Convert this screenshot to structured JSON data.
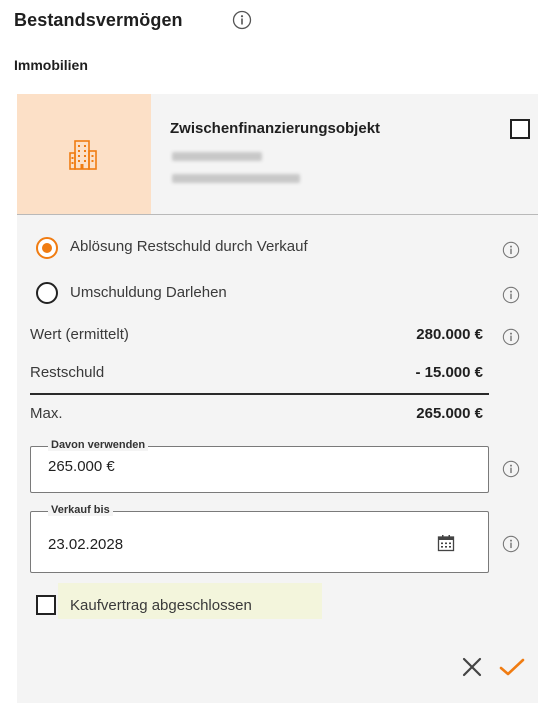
{
  "section": {
    "title": "Bestandsvermögen",
    "subtitle": "Immobilien"
  },
  "property": {
    "title": "Zwischenfinanzierungsobjekt",
    "address_line1": "Lehnstr. 10",
    "address_line2": "38678 Wolfsburg"
  },
  "options": {
    "selected": "ablösung",
    "ablösung_label": "Ablösung Restschuld durch Verkauf",
    "umschuldung_label": "Umschuldung Darlehen"
  },
  "values": {
    "wert_label": "Wert (ermittelt)",
    "wert_value": "280.000 €",
    "restschuld_label": "Restschuld",
    "restschuld_value": "- 15.000 €",
    "max_label": "Max.",
    "max_value": "265.000 €"
  },
  "inputs": {
    "davon_label": "Davon verwenden",
    "davon_value": "265.000 €",
    "verkauf_label": "Verkauf bis",
    "verkauf_value": "23.02.2028"
  },
  "kaufvertrag": {
    "label": "Kaufvertrag abgeschlossen",
    "checked": false
  },
  "icons": {
    "info": "info-icon",
    "building": "building-icon",
    "calendar": "calendar-icon",
    "cancel": "close-icon",
    "confirm": "check-icon"
  },
  "colors": {
    "accent": "#f07c12",
    "tile_bg": "#fce0c7",
    "card_bg": "#f4f4f4",
    "highlight_bg": "#f3f5dc"
  }
}
